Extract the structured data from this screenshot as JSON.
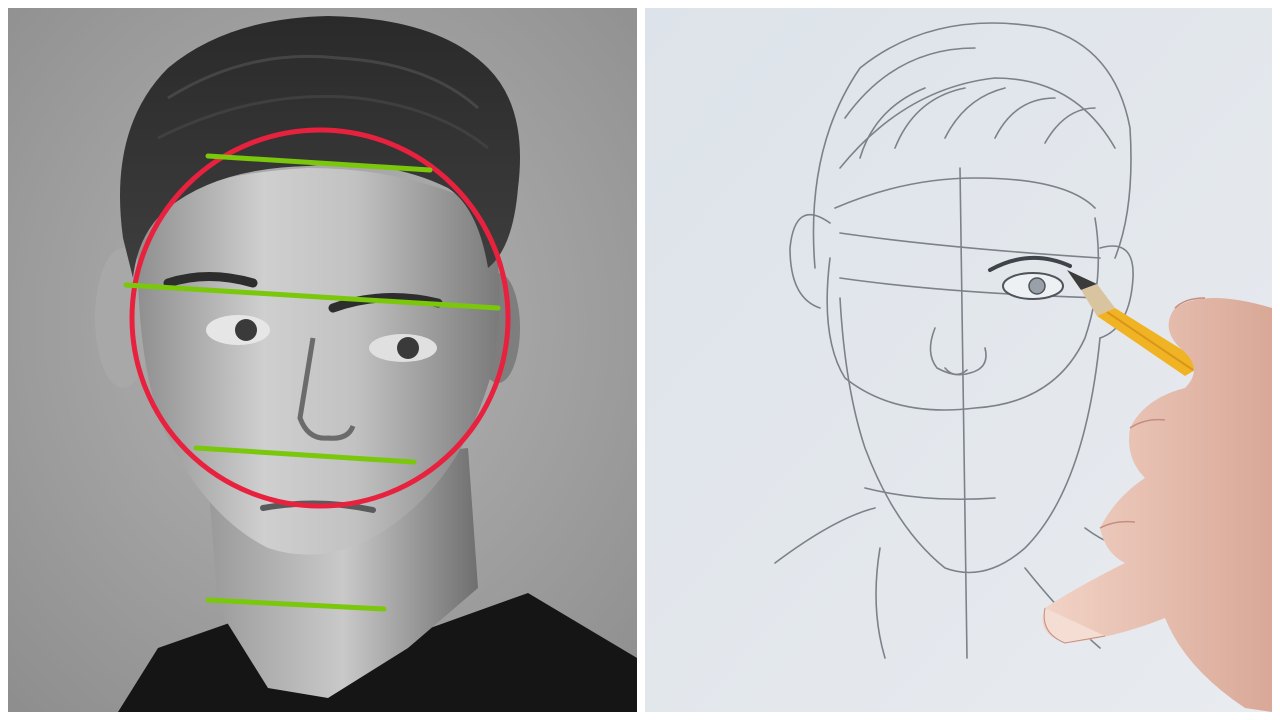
{
  "photo_panel": {
    "subject": "portrait-photo",
    "overlay_colors": {
      "circle": "#e8213f",
      "guide_lines": "#7ac70c"
    },
    "guide_line_count": 4
  },
  "sketch_panel": {
    "subject": "pencil-sketch",
    "colors": {
      "paper": "#dfe4ea",
      "graphite": "#6b7079",
      "pencil_body": "#f0b323",
      "skin": "#e9c2b4"
    }
  }
}
